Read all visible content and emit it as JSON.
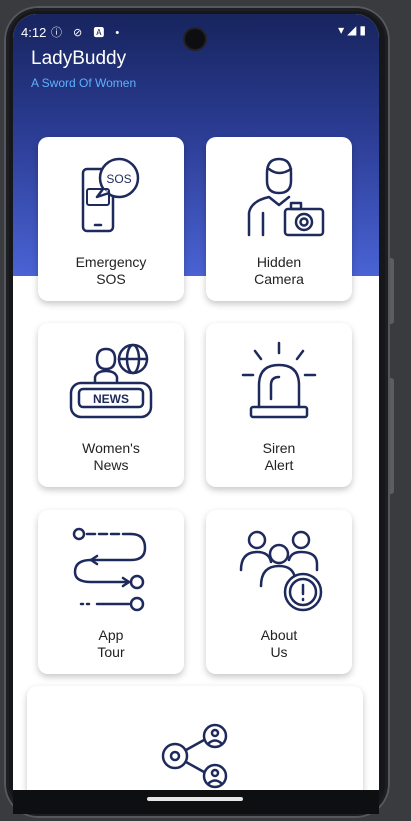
{
  "status_bar": {
    "time": "4:12",
    "left_icons": "ⓘ ⊘ 🅰 •",
    "right_icons": "▾◢▮"
  },
  "app": {
    "title": "LadyBuddy",
    "subtitle": "A Sword Of Women"
  },
  "colors": {
    "header_dark": "#17245e",
    "header_light": "#4a63d4",
    "subtitle": "#5fb0ff",
    "icon_stroke": "#1f2a5c"
  },
  "cards": [
    {
      "line1": "Emergency",
      "line2": "SOS",
      "icon": "sos-phone-icon"
    },
    {
      "line1": "Hidden",
      "line2": "Camera",
      "icon": "camera-person-icon"
    },
    {
      "line1": "Women's",
      "line2": "News",
      "icon": "news-anchor-icon"
    },
    {
      "line1": "Siren",
      "line2": "Alert",
      "icon": "siren-icon"
    },
    {
      "line1": "App",
      "line2": "Tour",
      "icon": "flowchart-icon"
    },
    {
      "line1": "About",
      "line2": "Us",
      "icon": "group-info-icon"
    }
  ],
  "sos_icon_text": "SOS",
  "news_icon_text": "NEWS",
  "wide_card": {
    "icon": "share-icon"
  }
}
